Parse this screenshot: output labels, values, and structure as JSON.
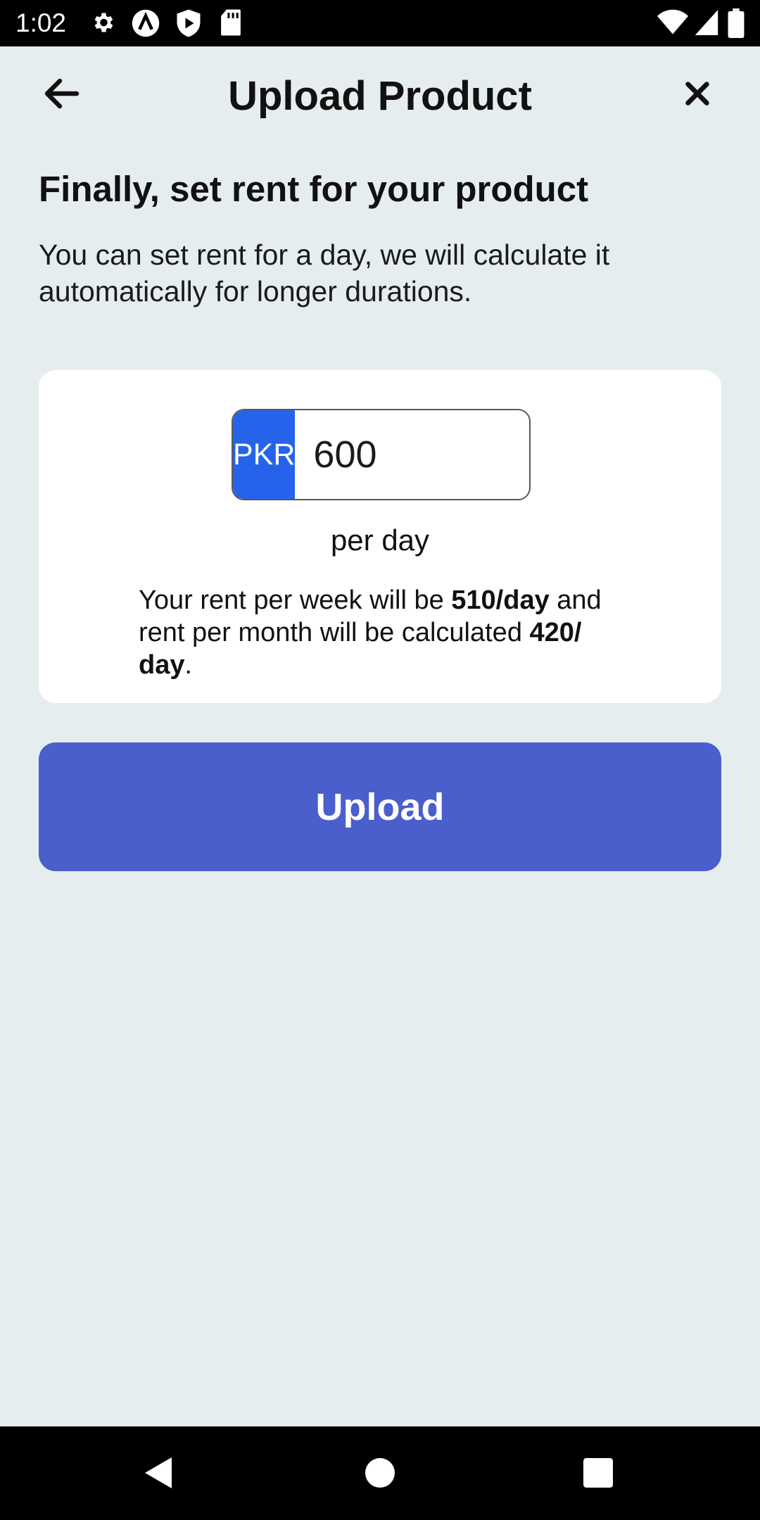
{
  "status_bar": {
    "time": "1:02",
    "icons": [
      "gear-icon",
      "app-a-icon",
      "play-protect-icon",
      "sd-card-icon",
      "wifi-icon",
      "signal-icon",
      "battery-icon"
    ]
  },
  "header": {
    "title": "Upload Product",
    "back_icon": "arrow-left-icon",
    "close_icon": "close-icon"
  },
  "content": {
    "heading": "Finally, set rent for your product",
    "description": "You can set rent for a day, we will calculate it automatically for longer durations."
  },
  "rent": {
    "currency": "PKR",
    "amount": "600",
    "unit": "per day",
    "note_prefix": "Your rent per week will be ",
    "week_rate": "510/day",
    "note_middle": " and rent per month will be calculated ",
    "month_rate": "420/ day",
    "note_suffix": "."
  },
  "actions": {
    "upload_label": "Upload"
  },
  "colors": {
    "background": "#e5edef",
    "currency_badge": "#2563eb",
    "upload_button": "#4a5fcc"
  }
}
